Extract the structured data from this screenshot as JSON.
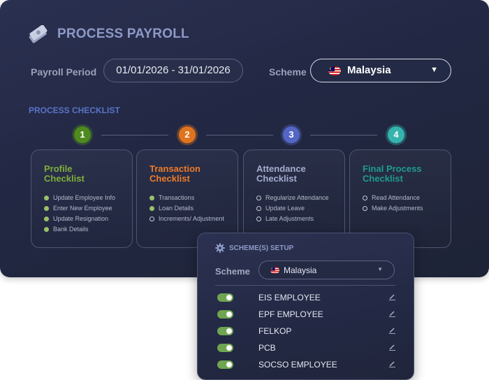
{
  "app": {
    "title": "PROCESS PAYROLL",
    "title_icon": "money-icon"
  },
  "payroll_period": {
    "label": "Payroll Period",
    "value": "01/01/2026 - 31/01/2026"
  },
  "scheme": {
    "label": "Scheme",
    "selected": "Malaysia",
    "flag_icon": "malaysia-flag-icon"
  },
  "checklist": {
    "heading": "PROCESS CHECKLIST",
    "steps": [
      {
        "number": "1",
        "color": "#4e8a1e",
        "title_line1": "Profile",
        "title_line2": "Checklist",
        "title_color": "#7fb038",
        "items": [
          {
            "label": "Update Employee Info",
            "status": "done"
          },
          {
            "label": "Enter New Employee",
            "status": "done"
          },
          {
            "label": "Update Resignation",
            "status": "done"
          },
          {
            "label": "Bank Details",
            "status": "done"
          }
        ]
      },
      {
        "number": "2",
        "color": "#e0731e",
        "title_line1": "Transaction",
        "title_line2": "Checklist",
        "title_color": "#ee7b2a",
        "items": [
          {
            "label": "Transactions",
            "status": "done"
          },
          {
            "label": "Loan Details",
            "status": "done"
          },
          {
            "label": "Increments/ Adjustment",
            "status": "open"
          }
        ]
      },
      {
        "number": "3",
        "color": "#5366c4",
        "title_line1": "Attendance",
        "title_line2": "Checklist",
        "title_color": "#a4adce",
        "items": [
          {
            "label": "Regularize Attendance",
            "status": "open"
          },
          {
            "label": "Update Leave",
            "status": "open"
          },
          {
            "label": "Late Adjustments",
            "status": "open"
          }
        ]
      },
      {
        "number": "4",
        "color": "#35b3ad",
        "title_line1": "Final Process",
        "title_line2": "Checklist",
        "title_color": "#1f9c8e",
        "items": [
          {
            "label": "Read Attendance",
            "status": "open"
          },
          {
            "label": "Make Adjustments",
            "status": "open"
          }
        ]
      }
    ]
  },
  "schemes_setup": {
    "title": "SCHEME(S) SETUP",
    "title_icon": "gear-icon",
    "scheme_label": "Scheme",
    "selected": "Malaysia",
    "rows": [
      {
        "label": "EIS EMPLOYEE",
        "enabled": true
      },
      {
        "label": "EPF EMPLOYEE",
        "enabled": true
      },
      {
        "label": "FELKOP",
        "enabled": true
      },
      {
        "label": "PCB",
        "enabled": true
      },
      {
        "label": "SOCSO EMPLOYEE",
        "enabled": true
      }
    ]
  },
  "colors": {
    "panel": "#232944",
    "accent_blue": "#5a73c8",
    "toggle_on": "#6fa552"
  }
}
